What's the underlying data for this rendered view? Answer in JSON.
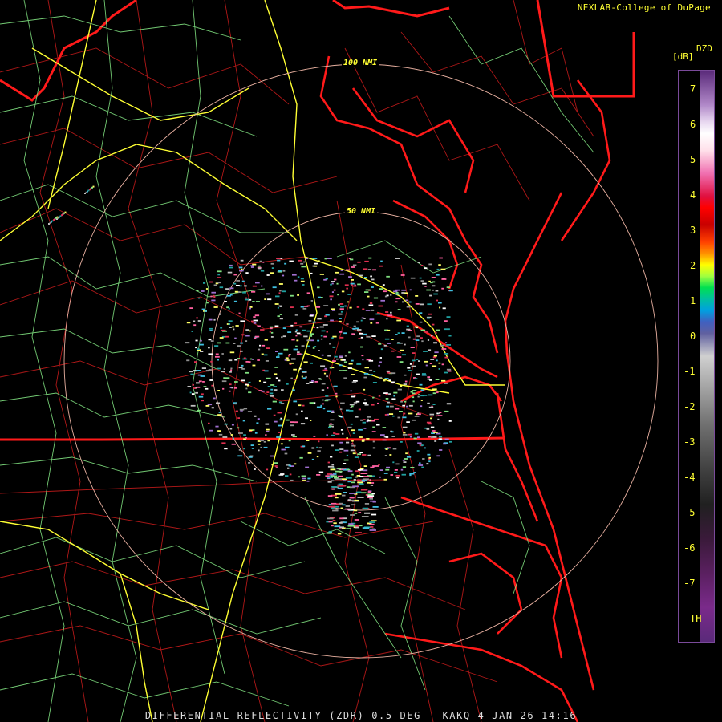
{
  "credit": "NEXLAB-College of DuPage",
  "colorbar": {
    "units": "[dB]",
    "name": "DZD",
    "ticks": [
      "7",
      "6",
      "5",
      "4",
      "3",
      "2",
      "1",
      "0",
      "-1",
      "-2",
      "-3",
      "-4",
      "-5",
      "-6",
      "-7",
      "TH"
    ]
  },
  "range_rings": {
    "inner_label": "50 NMI",
    "outer_label": "100 NMI"
  },
  "footer": "DIFFERENTIAL REFLECTIVITY (ZDR) 0.5 DEG - KAKQ 4 JAN 26 14:16",
  "colors": {
    "coast": "#ff1a1a",
    "county": "#cc2222",
    "road_major": "#ffff33",
    "road_minor": "#88ee88",
    "ring": "#e8b0a0"
  }
}
